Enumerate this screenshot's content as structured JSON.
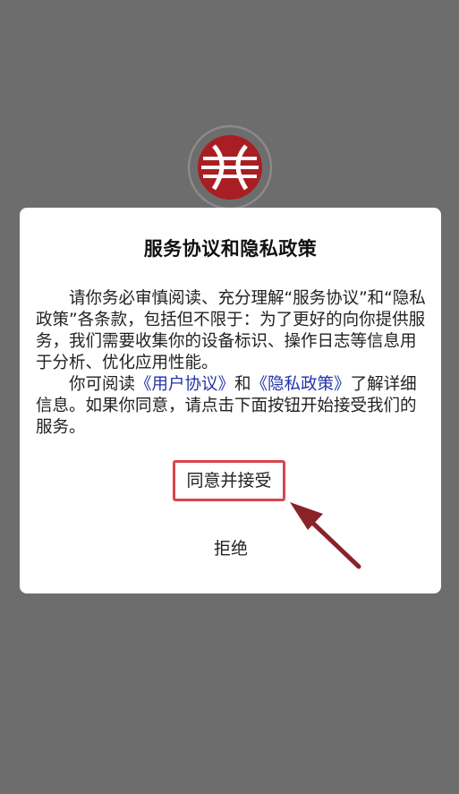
{
  "dialog": {
    "title": "服务协议和隐私政策",
    "paragraph1": "请你务必审慎阅读、充分理解“服务协议”和“隐私政策”各条款，包括但不限于：为了更好的向你提供服务，我们需要收集你的设备标识、操作日志等信息用于分析、优化应用性能。",
    "paragraph2_prefix": "你可阅读",
    "user_agreement_link": "《用户协议》",
    "paragraph2_and": "和",
    "privacy_policy_link": "《隐私政策》",
    "paragraph2_suffix": "了解详细信息。如果你同意，请点击下面按钮开始接受我们的服务。",
    "agree_label": "同意并接受",
    "reject_label": "拒绝"
  },
  "colors": {
    "overlay": "#6d6d6d",
    "link": "#2233aa",
    "highlight_border": "#d9454b",
    "arrow": "#8a2329",
    "logo": "#a81e22"
  },
  "icons": {
    "logo": "app-logo-icon",
    "arrow": "annotation-arrow-icon"
  }
}
